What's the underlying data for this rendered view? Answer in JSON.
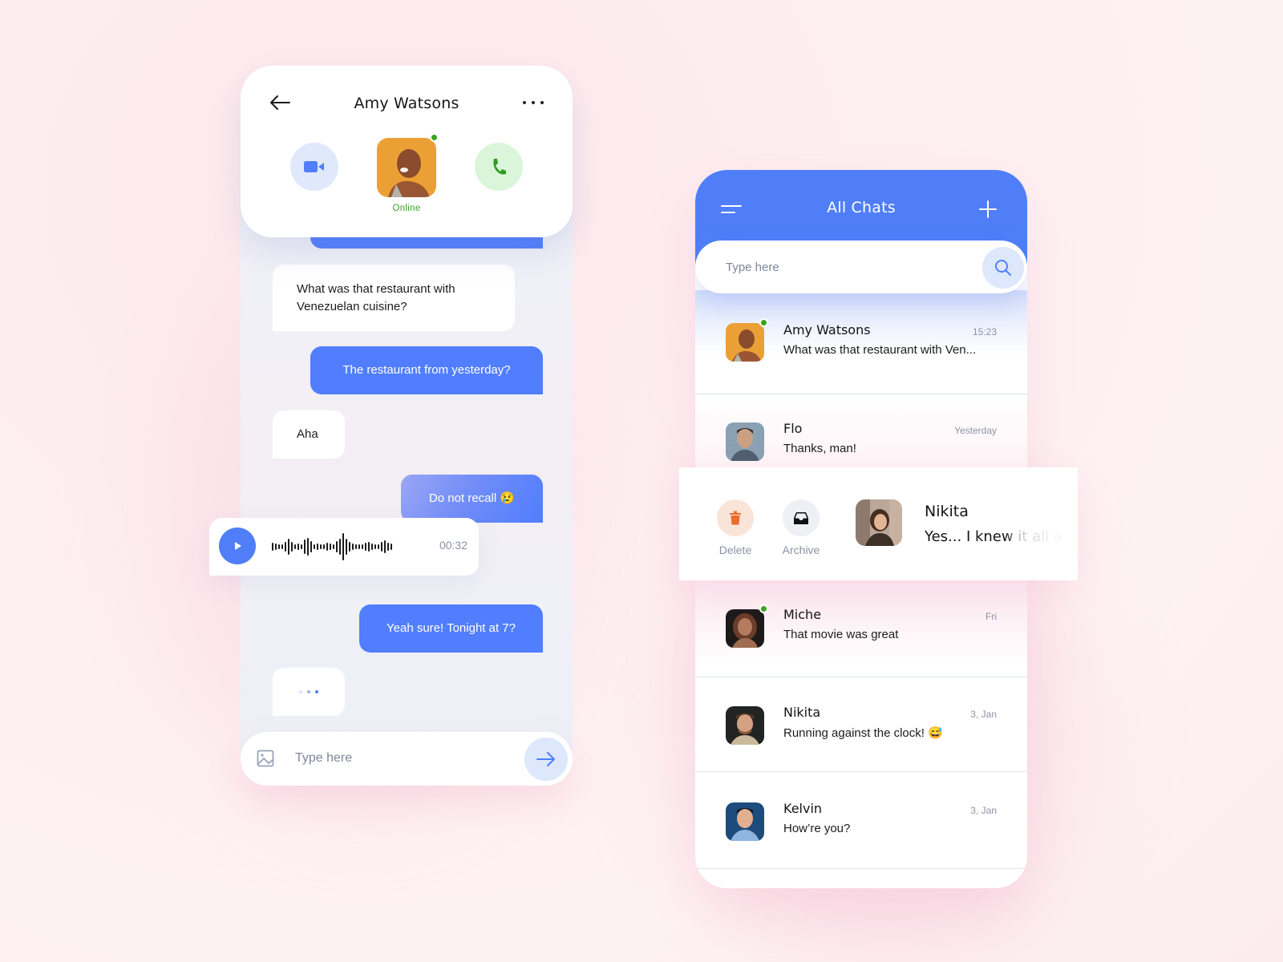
{
  "colors": {
    "accent": "#507efe",
    "online": "#38a31d",
    "muted_text": "#8b92a6",
    "video_bg": "#dfe9fb",
    "call_bg": "#dbf5da",
    "delete_bg": "#f9e5d8",
    "delete_icon": "#ec6b2d",
    "archive_bg": "#eef0f5"
  },
  "conversation": {
    "contact_name": "Amy Watsons",
    "status": "Online",
    "back_icon": "arrow-left-icon",
    "more_icon": "more-horizontal-icon",
    "video_icon": "video-camera-icon",
    "call_icon": "phone-icon",
    "messages": [
      {
        "direction": "in",
        "text": "What was that restaurant with Venezuelan cuisine?"
      },
      {
        "direction": "out",
        "text": "The restaurant from yesterday?"
      },
      {
        "direction": "in",
        "text": "Aha"
      },
      {
        "direction": "out",
        "text": "Do not recall 😢"
      },
      {
        "direction": "in",
        "type": "voice",
        "duration": "00:32"
      },
      {
        "direction": "out",
        "text": "Yeah sure! Tonight at 7?"
      },
      {
        "direction": "in",
        "type": "typing"
      }
    ],
    "composer": {
      "placeholder": "Type here",
      "attach_icon": "image-icon",
      "send_icon": "arrow-right-icon"
    }
  },
  "chat_list": {
    "title": "All Chats",
    "menu_icon": "menu-icon",
    "add_icon": "plus-icon",
    "search": {
      "placeholder": "Type here",
      "icon": "search-icon"
    },
    "chats": [
      {
        "name": "Amy Watsons",
        "preview": "What was that restaurant with Ven...",
        "time": "15:23",
        "online": true
      },
      {
        "name": "Flo",
        "preview": "Thanks, man!",
        "time": "Yesterday",
        "online": false
      },
      {
        "name": "Nikita",
        "preview": "Yes... I knew it all a",
        "time": "",
        "online": false,
        "swiped": true
      },
      {
        "name": "Miche",
        "preview": "That movie was great",
        "time": "Fri",
        "online": true
      },
      {
        "name": "Nikita",
        "preview": "Running against the clock! 😅",
        "time": "3, Jan",
        "online": false
      },
      {
        "name": "Kelvin",
        "preview": "How’re you?",
        "time": "3, Jan",
        "online": false
      }
    ],
    "swipe_actions": [
      {
        "label": "Delete",
        "icon": "trash-icon"
      },
      {
        "label": "Archive",
        "icon": "archive-tray-icon"
      }
    ]
  }
}
